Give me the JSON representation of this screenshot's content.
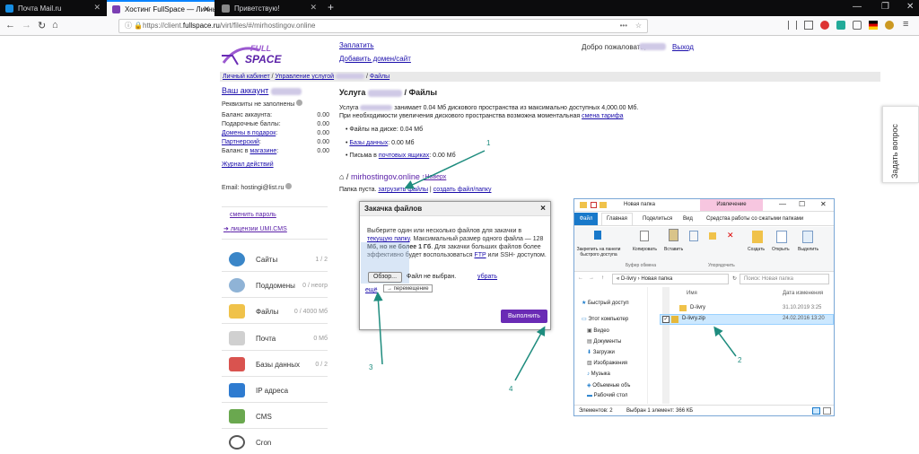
{
  "browser": {
    "tabs": [
      {
        "label": "Почта Mail.ru",
        "color": "#168de2"
      },
      {
        "label": "Хостинг FullSpace — Личный ка",
        "color": "#7b3fb3"
      },
      {
        "label": "Приветствую!",
        "color": "#888"
      }
    ],
    "url_prefix": "https://client.",
    "url_domain": "fullspace.ru",
    "url_path": "/virt/files/#/mirhostingov.online"
  },
  "header": {
    "logo_full": "FULL",
    "logo_space": "SPACE",
    "pay": "Заплатить",
    "add_domain": "Добавить домен/сайт",
    "welcome": "Добро пожаловать,",
    "logout": "Выход"
  },
  "breadcrumb": {
    "a": "Личный кабинет",
    "sep1": " / ",
    "b": "Управление услугой",
    "sep2": " / ",
    "c": "Файлы"
  },
  "sidebar": {
    "account": "Ваш аккаунт",
    "requisites": "Реквизиты не заполнены",
    "balances": [
      {
        "label": "Баланс аккаунта:",
        "value": "0.00",
        "link": false
      },
      {
        "label": "Подарочные баллы:",
        "value": "0.00",
        "link": false
      },
      {
        "label": "Домены в подарок",
        "value": "0.00",
        "link": true
      },
      {
        "label": "Партнерский",
        "value": "0.00",
        "link": true
      },
      {
        "label": "Баланс в ",
        "value": "0.00",
        "link": false,
        "link2": "магазине"
      }
    ],
    "journal": "Журнал действий",
    "email": "Email: hostingi@list.ru",
    "change_pw": "сменить пароль",
    "licenses": "лицензии UMI.CMS",
    "menu": [
      {
        "label": "Сайты",
        "count": "1 / 2",
        "color": "#3a86c8",
        "icon": "sites-icon"
      },
      {
        "label": "Поддомены",
        "count": "0 / неогр",
        "color": "#8fb3d6",
        "icon": "subdomains-icon"
      },
      {
        "label": "Файлы",
        "count": "0 / 4000 Мб",
        "color": "#f0c24a",
        "icon": "files-icon"
      },
      {
        "label": "Почта",
        "count": "0 Мб",
        "color": "#c9c9c9",
        "icon": "mail-icon"
      },
      {
        "label": "Базы данных",
        "count": "0 / 2",
        "color": "#d9534f",
        "icon": "databases-icon"
      },
      {
        "label": "IP адреса",
        "count": "",
        "color": "#2e7bd0",
        "icon": "ip-icon"
      },
      {
        "label": "CMS",
        "count": "",
        "color": "#6aa84f",
        "icon": "cms-icon"
      },
      {
        "label": "Cron",
        "count": "",
        "color": "#555",
        "icon": "cron-icon"
      }
    ]
  },
  "main": {
    "title_pre": "Услуга",
    "title_post": "/ Файлы",
    "usage_a": "Услуга",
    "usage_b": "занимает 0.04 Мб дискового пространства из максимально доступных 4,000.00 Мб.",
    "usage2": "При необходимости увеличения дискового пространства возможна моментальная",
    "change_plan": "смена тарифа",
    "files_on_disk": "Файлы на диске: 0.04 Мб",
    "db_link": "Базы данных",
    "db_val": ": 0.00 Мб",
    "mail_pre": "Письма в ",
    "mail_link": "почтовых ящиках",
    "mail_val": ": 0.00 Мб",
    "path_root": "⌂ /",
    "path_dir": "mirhostingov.online",
    "up": "Наверх",
    "empty": "Папка пуста.",
    "upload": "загрузить файлы",
    "create": "создать файл/папку"
  },
  "dialog": {
    "title": "Закачка файлов",
    "close": "×",
    "text1": "Выберите один или несколько файлов для закачки в",
    "current": "текущую папку",
    "text2": ". Максимальный размер одного файла — 128",
    "text3": "Мб, но не более 1 Гб",
    "text4": ". Для закачки больших файлов",
    "text5": "более эффективно будет воспользоваться",
    "ftp": "FTP",
    "text6": " или SSH-",
    "text7": "доступом.",
    "browse": "Обзор...",
    "no_file": "Файл не выбран.",
    "remove": "убрать",
    "more": "ещё",
    "move_hint": "→ перемещение",
    "run": "Выполнить"
  },
  "explorer": {
    "title": "Новая папка",
    "extract": "Извлечение",
    "tabs": [
      "Файл",
      "Главная",
      "Поделиться",
      "Вид",
      "Средства работы со сжатыми папками"
    ],
    "ribbon": [
      "Закрепить на панели быстрого доступа",
      "Копировать",
      "Вставить",
      "Создать",
      "Открыть",
      "Выделить"
    ],
    "clipboard": "Буфер обмена",
    "organize": "Упорядочить",
    "address": "« D-livry › Новая папка",
    "search": "Поиск: Новая папка",
    "col_name": "Имя",
    "col_date": "Дата изменения",
    "nav": [
      "Быстрый доступ",
      "Этот компьютер",
      "Видео",
      "Документы",
      "Загрузки",
      "Изображения",
      "Музыка",
      "Объемные объ",
      "Рабочий стол"
    ],
    "files": [
      {
        "name": "D-livry",
        "date": "31.10.2019 3:25"
      },
      {
        "name": "D-livry.zip",
        "date": "24.02.2016 13:20"
      }
    ],
    "status_items": "Элементов: 2",
    "status_sel": "Выбран 1 элемент: 366 КБ"
  },
  "side_tab": "Задать вопрос",
  "annotations": [
    "1",
    "2",
    "3",
    "4"
  ]
}
